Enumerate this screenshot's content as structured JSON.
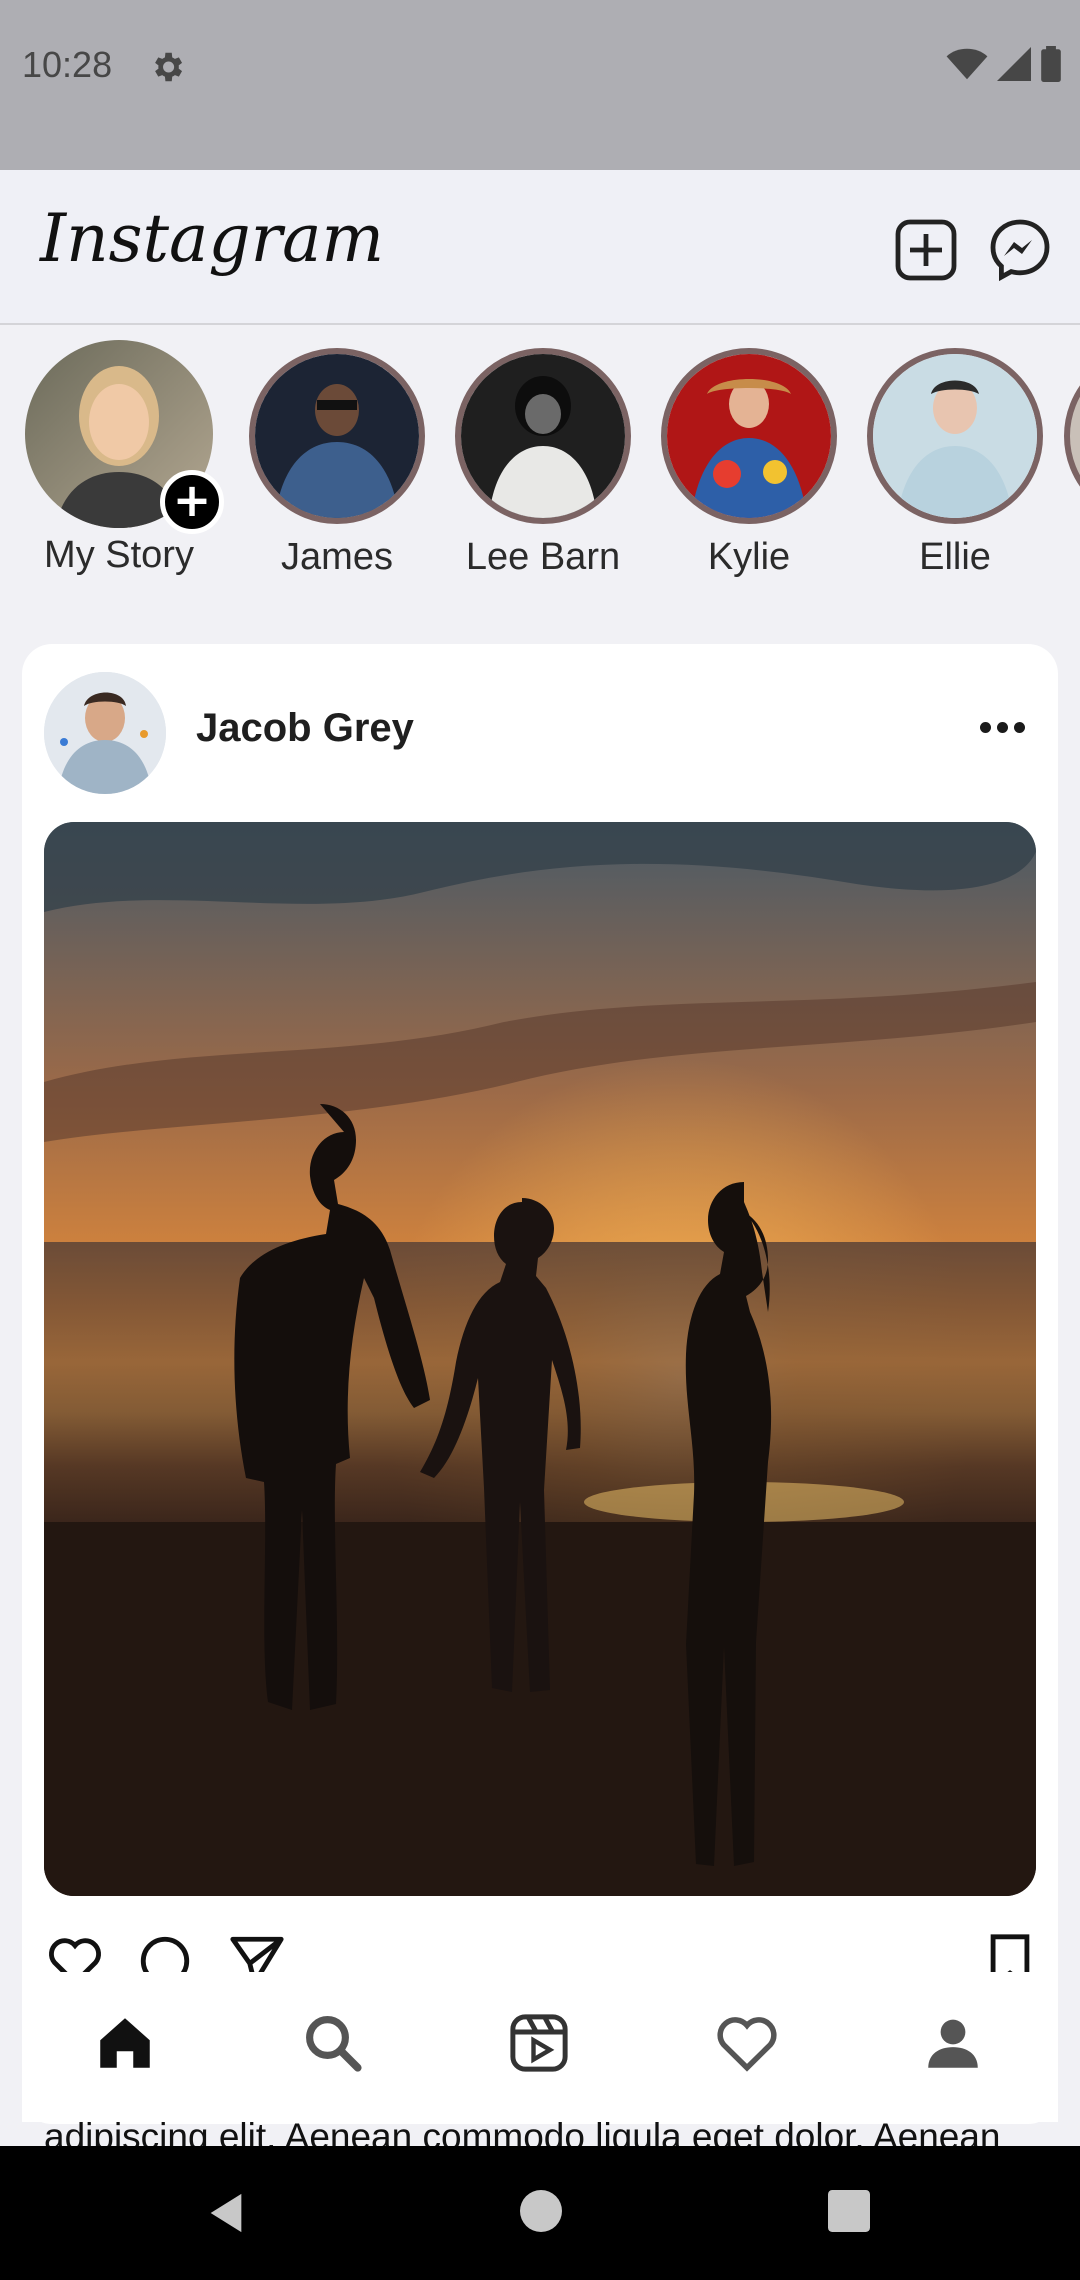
{
  "status_bar": {
    "time": "10:28"
  },
  "app_bar": {
    "logo": "Instagram",
    "icons": [
      "add-post-icon",
      "messenger-icon"
    ]
  },
  "stories": [
    {
      "label": "My Story",
      "is_own": true
    },
    {
      "label": "James"
    },
    {
      "label": "Lee Barn"
    },
    {
      "label": "Kylie"
    },
    {
      "label": "Ellie"
    }
  ],
  "post": {
    "username": "Jacob Grey",
    "caption": "adipiscing elit. Aenean commodo ligula eget dolor. Aenean"
  },
  "bottom_nav": [
    "home-icon",
    "search-icon",
    "reels-icon",
    "heart-icon",
    "profile-icon"
  ],
  "colors": {
    "story_ring": "#7b6363",
    "accent": "#000000"
  }
}
